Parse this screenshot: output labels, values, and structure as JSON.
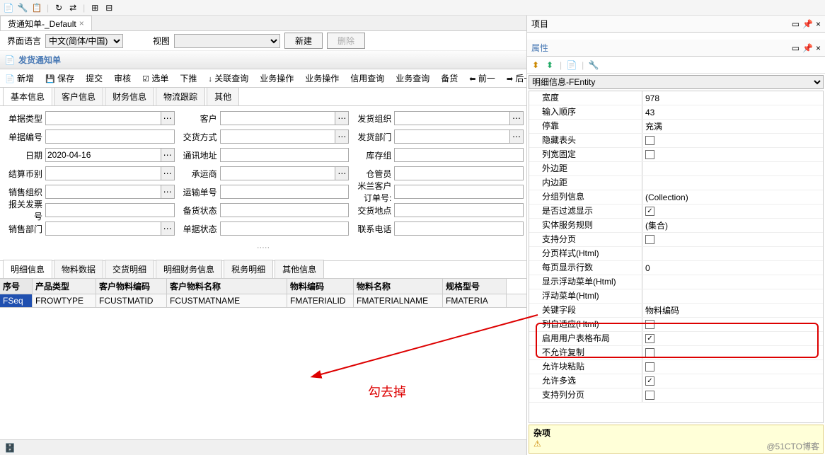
{
  "tab_title": "货通知单-_Default",
  "lang_label": "界面语言",
  "lang_value": "中文(简体/中国)",
  "view_label": "视图",
  "btn_new": "新建",
  "btn_delete": "删除",
  "doc_title": "发货通知单",
  "actions": [
    "新增",
    "保存",
    "提交",
    "审核",
    "选单",
    "下推",
    "关联查询",
    "业务操作",
    "业务操作",
    "信用查询",
    "业务查询",
    "备货",
    "前一",
    "后一"
  ],
  "sub_tabs": [
    "基本信息",
    "客户信息",
    "财务信息",
    "物流跟踪",
    "其他"
  ],
  "form": {
    "col1": [
      {
        "label": "单据类型",
        "type": "dots"
      },
      {
        "label": "单据编号",
        "type": "plain"
      },
      {
        "label": "日期",
        "type": "dots",
        "value": "2020-04-16"
      },
      {
        "label": "结算币别",
        "type": "dots"
      },
      {
        "label": "销售组织",
        "type": "dots"
      },
      {
        "label": "报关发票号",
        "type": "plain"
      },
      {
        "label": "销售部门",
        "type": "dots"
      }
    ],
    "col2": [
      {
        "label": "客户",
        "type": "dots"
      },
      {
        "label": "交货方式",
        "type": "dots"
      },
      {
        "label": "通讯地址",
        "type": "plain"
      },
      {
        "label": "承运商",
        "type": "dots"
      },
      {
        "label": "运输单号",
        "type": "plain"
      },
      {
        "label": "备货状态",
        "type": "plain"
      },
      {
        "label": "单据状态",
        "type": "plain"
      }
    ],
    "col3": [
      {
        "label": "发货组织",
        "type": "dots"
      },
      {
        "label": "发货部门",
        "type": "dots"
      },
      {
        "label": "库存组",
        "type": "plain"
      },
      {
        "label": "仓管员",
        "type": "plain"
      },
      {
        "label": "米兰客户订单号:",
        "type": "plain"
      },
      {
        "label": "交货地点",
        "type": "plain"
      },
      {
        "label": "联系电话",
        "type": "plain"
      }
    ]
  },
  "detail_tabs": [
    "明细信息",
    "物料数据",
    "交货明细",
    "明细财务信息",
    "税务明细",
    "其他信息"
  ],
  "grid_headers": [
    "序号",
    "产品类型",
    "客户物料编码",
    "客户物料名称",
    "物料编码",
    "物料名称",
    "规格型号"
  ],
  "grid_fields": [
    "FSeq",
    "FROWTYPE",
    "FCUSTMATID",
    "FCUSTMATNAME",
    "FMATERIALID",
    "FMATERIALNAME",
    "FMATERIA"
  ],
  "grid_widths": [
    46,
    90,
    100,
    170,
    94,
    126,
    90
  ],
  "annotation_text": "勾去掉",
  "watermark_text": "@51CTO博客",
  "right_panel_title": "项目",
  "prop_panel_title": "属性",
  "prop_selected": "明细信息-FEntity",
  "props": [
    {
      "n": "宽度",
      "v": "978"
    },
    {
      "n": "输入顺序",
      "v": "43"
    },
    {
      "n": "停靠",
      "v": "充满"
    },
    {
      "n": "隐藏表头",
      "v": "",
      "chk": false
    },
    {
      "n": "列宽固定",
      "v": "",
      "chk": false
    },
    {
      "n": "外边距",
      "v": ""
    },
    {
      "n": "内边距",
      "v": ""
    },
    {
      "n": "分组列信息",
      "v": "(Collection)"
    },
    {
      "n": "是否过滤显示",
      "v": "",
      "chk": true
    },
    {
      "n": "实体服务规则",
      "v": "(集合)"
    },
    {
      "n": "支持分页",
      "v": "",
      "chk": false
    },
    {
      "n": "分页样式(Html)",
      "v": ""
    },
    {
      "n": "每页显示行数",
      "v": "0"
    },
    {
      "n": "显示浮动菜单(Html)",
      "v": ""
    },
    {
      "n": "浮动菜单(Html)",
      "v": ""
    },
    {
      "n": "关键字段",
      "v": "物料编码"
    },
    {
      "n": "列自适应(Html)",
      "v": "",
      "chk": false
    },
    {
      "n": "启用用户表格布局",
      "v": "",
      "chk": true,
      "hl": true
    },
    {
      "n": "不允许复制",
      "v": "",
      "chk": false
    },
    {
      "n": "允许块粘贴",
      "v": "",
      "chk": false
    },
    {
      "n": "允许多选",
      "v": "",
      "chk": true
    },
    {
      "n": "支持列分页",
      "v": "",
      "chk": false
    }
  ],
  "misc_label": "杂项"
}
